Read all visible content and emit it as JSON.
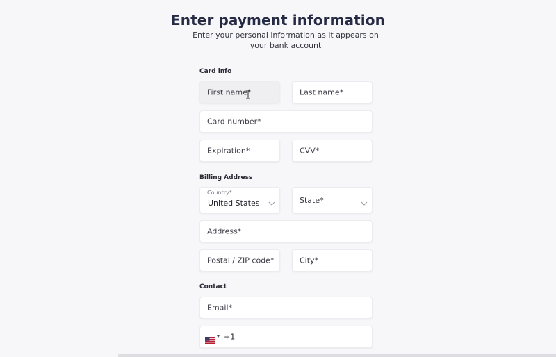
{
  "header": {
    "title": "Enter payment information",
    "subtitle": "Enter your personal information as it appears on your bank account"
  },
  "card_info": {
    "section_label": "Card info",
    "first_name_placeholder": "First name*",
    "last_name_placeholder": "Last name*",
    "card_number_placeholder": "Card number*",
    "expiration_placeholder": "Expiration*",
    "cvv_placeholder": "CVV*"
  },
  "billing": {
    "section_label": "Billing Address",
    "country_label": "Country*",
    "country_value": "United States",
    "state_placeholder": "State*",
    "address_placeholder": "Address*",
    "postal_placeholder": "Postal / ZIP code*",
    "city_placeholder": "City*"
  },
  "contact": {
    "section_label": "Contact",
    "email_placeholder": "Email*",
    "phone_country_icon": "us-flag-icon",
    "phone_dial_code": "+1"
  },
  "colors": {
    "background": "#f7f7fa",
    "field_background": "#ffffff",
    "hovered_field_background": "#efeff2",
    "title_color": "#262b44"
  }
}
